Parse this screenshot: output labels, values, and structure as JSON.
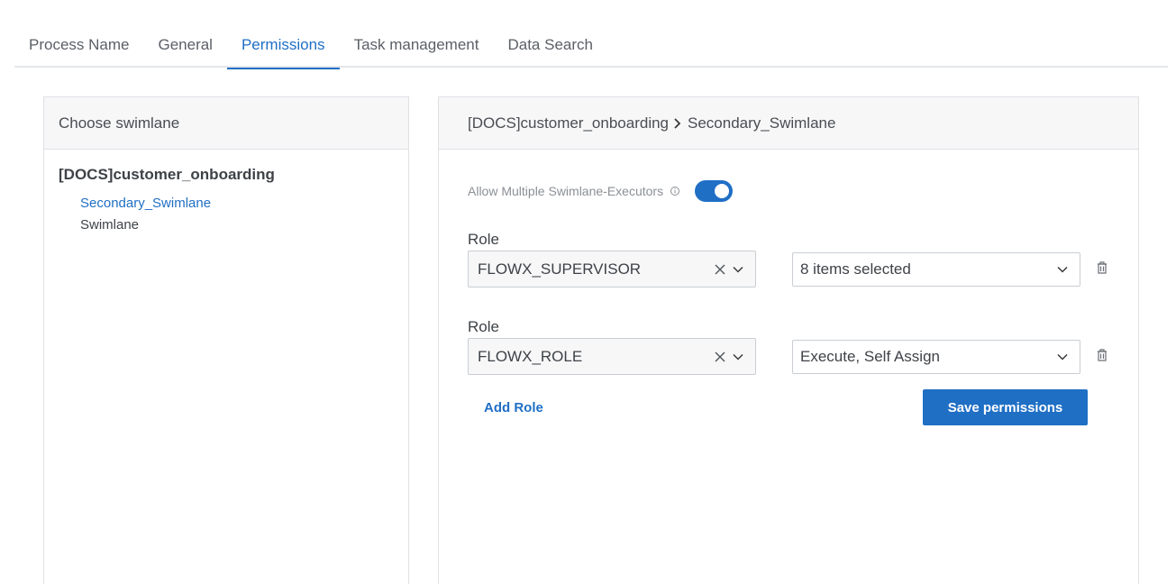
{
  "tabs": [
    {
      "label": "Process Name"
    },
    {
      "label": "General"
    },
    {
      "label": "Permissions",
      "active": true
    },
    {
      "label": "Task management"
    },
    {
      "label": "Data Search"
    }
  ],
  "left_panel": {
    "title": "Choose swimlane",
    "process": "[DOCS]customer_onboarding",
    "swimlanes": [
      "Secondary_Swimlane",
      "Swimlane"
    ]
  },
  "right_panel": {
    "breadcrumb": {
      "process": "[DOCS]customer_onboarding",
      "swimlane": "Secondary_Swimlane"
    },
    "allow_label": "Allow Multiple Swimlane-Executors",
    "allow_enabled": true,
    "roles": [
      {
        "label": "Role",
        "role": "FLOWX_SUPERVISOR",
        "permissions": "8 items selected"
      },
      {
        "label": "Role",
        "role": "FLOWX_ROLE",
        "permissions": "Execute, Self Assign"
      }
    ],
    "add_role_label": "Add Role",
    "save_label": "Save permissions"
  },
  "colors": {
    "accent": "#1f6fc5",
    "header_bg": "#f7f7f8",
    "border": "#dfe1e5"
  }
}
